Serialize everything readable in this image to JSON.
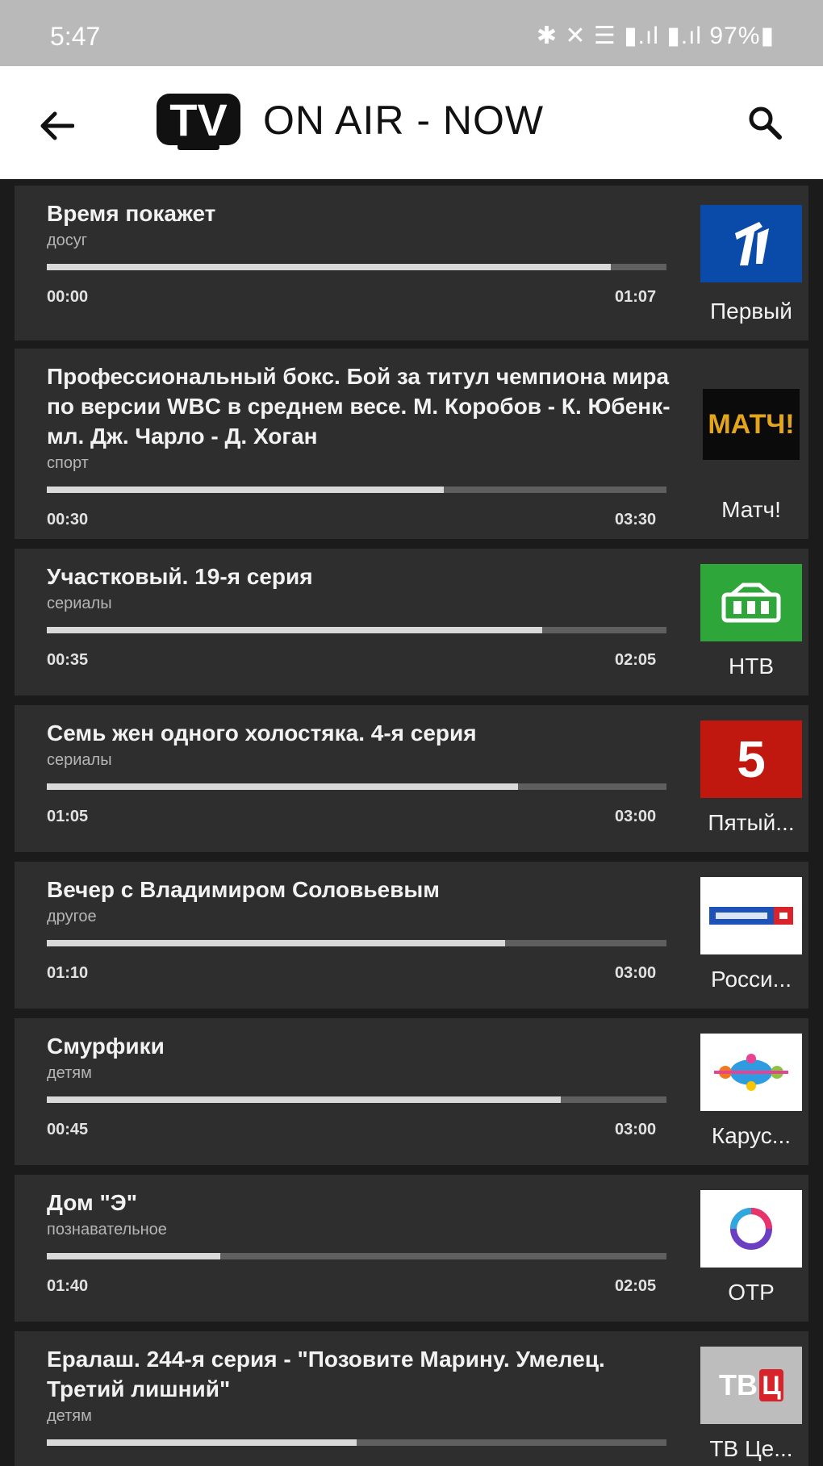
{
  "status_bar": {
    "time": "5:47",
    "right": "✱ ✕ ☰ ▮.ıl ▮.ıl 97%▮"
  },
  "app_bar": {
    "logo_text": "TV",
    "title": "ON AIR - NOW"
  },
  "icons": {
    "back": "arrow-left",
    "search": "magnifier"
  },
  "programs": [
    {
      "title": "Время покажет",
      "genre": "досуг",
      "progress": 0.91,
      "start": "00:00",
      "end": "01:07",
      "channel": "Первый",
      "logo": "pervyi"
    },
    {
      "title": "Профессиональный бокс. Бой за титул чемпиона мира по версии WBC в среднем весе. М. Коробов - К. Юбенк-мл. Дж. Чарло - Д. Хоган",
      "genre": "спорт",
      "progress": 0.64,
      "start": "00:30",
      "end": "03:30",
      "channel": "Матч!",
      "logo": "match"
    },
    {
      "title": "Участковый. 19-я серия",
      "genre": "сериалы",
      "progress": 0.8,
      "start": "00:35",
      "end": "02:05",
      "channel": "НТВ",
      "logo": "ntv"
    },
    {
      "title": "Семь жен одного холостяка. 4-я серия",
      "genre": "сериалы",
      "progress": 0.76,
      "start": "01:05",
      "end": "03:00",
      "channel": "Пятый...",
      "logo": "five"
    },
    {
      "title": "Вечер с Владимиром Соловьевым",
      "genre": "другое",
      "progress": 0.74,
      "start": "01:10",
      "end": "03:00",
      "channel": "Росси...",
      "logo": "russia1"
    },
    {
      "title": "Смурфики",
      "genre": "детям",
      "progress": 0.83,
      "start": "00:45",
      "end": "03:00",
      "channel": "Карус...",
      "logo": "karusel"
    },
    {
      "title": "Дом \"Э\"",
      "genre": "познавательное",
      "progress": 0.28,
      "start": "01:40",
      "end": "02:05",
      "channel": "ОТР",
      "logo": "otr"
    },
    {
      "title": "Ералаш. 244-я серия - \"Позовите Марину. Умелец. Третий лишний\"",
      "genre": "детям",
      "progress": 0.5,
      "start": "",
      "end": "",
      "channel": "ТВ Це...",
      "logo": "tvc"
    }
  ],
  "colors": {
    "app_bar": "#ffffff",
    "card": "#2e2e2e",
    "background": "#1b1b1b",
    "accent": "#d9d9d9"
  }
}
